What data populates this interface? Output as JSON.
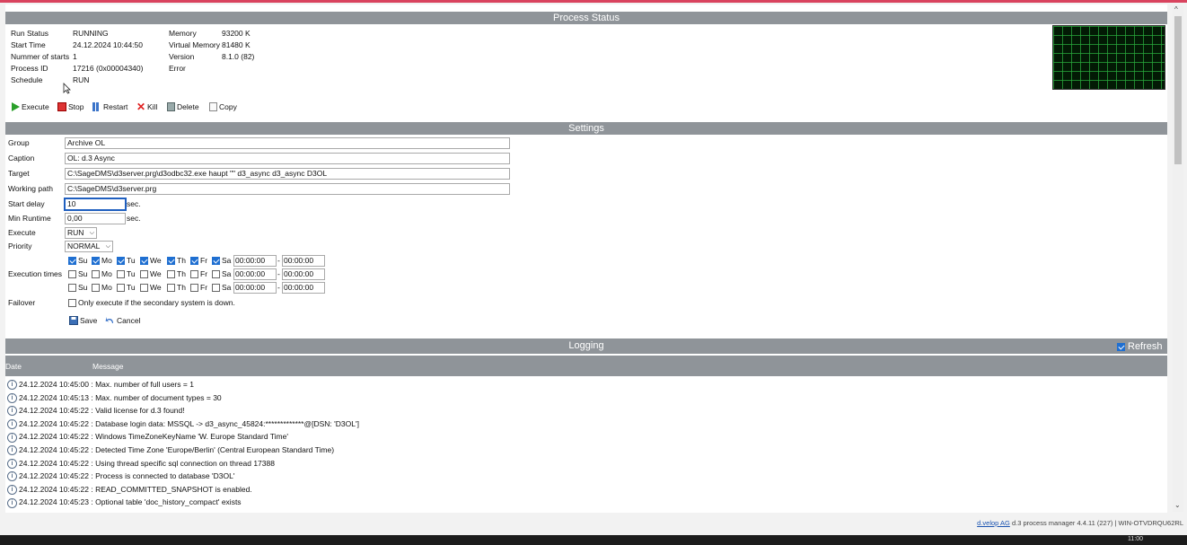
{
  "process_status": {
    "title": "Process Status",
    "fields": [
      {
        "label": "Run Status",
        "value": "RUNNING"
      },
      {
        "label": "Start Time",
        "value": "24.12.2024 10:44:50"
      },
      {
        "label": "Nummer of starts",
        "value": "1"
      },
      {
        "label": "Process ID",
        "value": "17216 (0x00004340)"
      },
      {
        "label": "Schedule",
        "value": "RUN"
      }
    ],
    "fields2": [
      {
        "label": "Memory",
        "value": "93200 K"
      },
      {
        "label": "Virtual Memory",
        "value": "81480 K"
      },
      {
        "label": "Version",
        "value": "8.1.0 (82)"
      },
      {
        "label": "Error",
        "value": ""
      }
    ]
  },
  "toolbar": {
    "execute": "Execute",
    "stop": "Stop",
    "restart": "Restart",
    "kill": "Kill",
    "delete": "Delete",
    "copy": "Copy"
  },
  "settings": {
    "title": "Settings",
    "group": {
      "label": "Group",
      "value": "Archive OL"
    },
    "caption": {
      "label": "Caption",
      "value": "OL: d.3 Async"
    },
    "target": {
      "label": "Target",
      "value": "C:\\SageDMS\\d3server.prg\\d3odbc32.exe haupt \"\" d3_async d3_async D3OL"
    },
    "working_path": {
      "label": "Working path",
      "value": "C:\\SageDMS\\d3server.prg"
    },
    "start_delay": {
      "label": "Start delay",
      "value": "10",
      "unit": "sec."
    },
    "min_runtime": {
      "label": "Min Runtime",
      "value": "0,00",
      "unit": "sec."
    },
    "execute": {
      "label": "Execute",
      "value": "RUN"
    },
    "priority": {
      "label": "Priority",
      "value": "NORMAL"
    },
    "execution_times_label": "Execution times",
    "days": [
      "Su",
      "Mo",
      "Tu",
      "We",
      "Th",
      "Fr",
      "Sa"
    ],
    "rows": [
      {
        "checked": [
          true,
          true,
          true,
          true,
          true,
          true,
          true
        ],
        "from": "00:00:00",
        "to": "00:00:00"
      },
      {
        "checked": [
          false,
          false,
          false,
          false,
          false,
          false,
          false
        ],
        "from": "00:00:00",
        "to": "00:00:00"
      },
      {
        "checked": [
          false,
          false,
          false,
          false,
          false,
          false,
          false
        ],
        "from": "00:00:00",
        "to": "00:00:00"
      }
    ],
    "range_sep": "-",
    "failover": {
      "label": "Failover",
      "option": "Only execute if the secondary system is down.",
      "checked": false
    },
    "save": "Save",
    "cancel": "Cancel"
  },
  "logging": {
    "title": "Logging",
    "refresh": "Refresh",
    "refresh_checked": true,
    "columns": {
      "date": "Date",
      "message": "Message"
    },
    "rows": [
      {
        "date": "24.12.2024 10:45:00",
        "message": ": Max. number of full users = 1"
      },
      {
        "date": "24.12.2024 10:45:13",
        "message": ": Max. number of document types = 30"
      },
      {
        "date": "24.12.2024 10:45:22",
        "message": ": Valid license for d.3 found!"
      },
      {
        "date": "24.12.2024 10:45:22",
        "message": ": Database login data: MSSQL -> d3_async_45824:*************@[DSN: 'D3OL']"
      },
      {
        "date": "24.12.2024 10:45:22",
        "message": ": Windows TimeZoneKeyName 'W. Europe Standard Time'"
      },
      {
        "date": "24.12.2024 10:45:22",
        "message": ": Detected Time Zone 'Europe/Berlin' (Central European Standard Time)"
      },
      {
        "date": "24.12.2024 10:45:22",
        "message": ": Using thread specific sql connection on thread 17388"
      },
      {
        "date": "24.12.2024 10:45:22",
        "message": ": Process is connected to database 'D3OL'"
      },
      {
        "date": "24.12.2024 10:45:22",
        "message": ": READ_COMMITTED_SNAPSHOT is enabled."
      },
      {
        "date": "24.12.2024 10:45:23",
        "message": ": Optional table 'doc_history_compact' exists"
      }
    ]
  },
  "footer": {
    "link": "d.velop AG",
    "text": "d.3 process manager 4.4.11 (227) | WIN-OTVDRQU62RL",
    "clock": "11:00"
  }
}
